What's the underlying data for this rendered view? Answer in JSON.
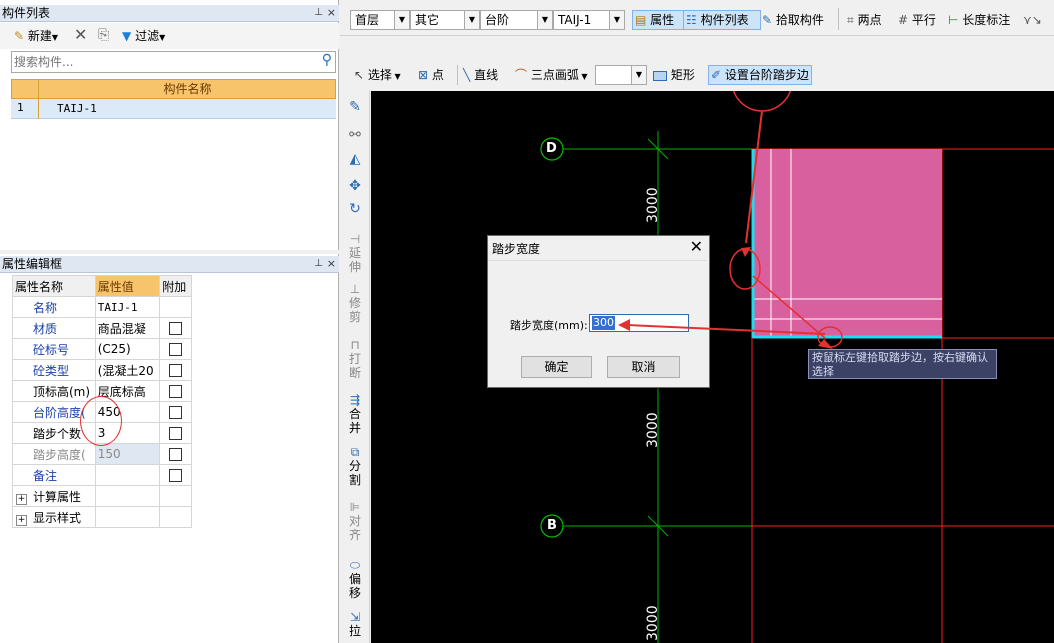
{
  "component_list_panel": {
    "title": "构件列表",
    "pin": "⊥",
    "close": "×",
    "new_label": "新建",
    "filter_label": "过滤",
    "search_placeholder": "搜索构件...",
    "column_header": "构件名称",
    "rows": [
      {
        "num": "1",
        "name": "TAIJ-1"
      }
    ]
  },
  "property_panel": {
    "title": "属性编辑框",
    "headers": {
      "name": "属性名称",
      "value": "属性值",
      "extra": "附加"
    },
    "rows": [
      {
        "name": "名称",
        "value": "TAIJ-1"
      },
      {
        "name": "材质",
        "value": "商品混凝"
      },
      {
        "name": "砼标号",
        "value": "(C25)"
      },
      {
        "name": "砼类型",
        "value": "(混凝土20"
      },
      {
        "name": "顶标高(m)",
        "value": "层底标高"
      },
      {
        "name": "台阶高度(",
        "value": "450"
      },
      {
        "name": "踏步个数",
        "value": "3"
      },
      {
        "name": "踏步高度(",
        "value": "150"
      },
      {
        "name": "备注",
        "value": ""
      }
    ],
    "groups": [
      "计算属性",
      "显示样式"
    ]
  },
  "toolbar1": {
    "floor": "首层",
    "category": "其它",
    "type": "台阶",
    "component": "TAIJ-1",
    "properties_label": "属性",
    "component_list_label": "构件列表",
    "pick_component_label": "拾取构件",
    "two_point_label": "两点",
    "parallel_label": "平行",
    "length_dim_label": "长度标注"
  },
  "toolbar2": {
    "select_label": "选择",
    "point_label": "点",
    "line_label": "直线",
    "arc_label": "三点画弧",
    "rect_label": "矩形",
    "set_step_edge_label": "设置台阶踏步边"
  },
  "side_tools": [
    {
      "label": "延伸"
    },
    {
      "label": "修剪"
    },
    {
      "label": "打断"
    },
    {
      "label": "合并"
    },
    {
      "label": "分割"
    },
    {
      "label": "对齐"
    },
    {
      "label": "偏移"
    },
    {
      "label": "拉"
    }
  ],
  "canvas": {
    "axis_d": "D",
    "axis_b": "B",
    "dim_top": "3000",
    "dim_mid": "3000",
    "dim_bottom": "3000",
    "tooltip": "按鼠标左键拾取踏步边，按右键确认选择"
  },
  "dialog": {
    "title": "踏步宽度",
    "field_label": "踏步宽度(mm):",
    "field_value": "300",
    "ok_label": "确定",
    "cancel_label": "取消"
  },
  "colors": {
    "canvas_bg": "#000000",
    "step_fill": "#d9609f",
    "cyan_edge": "#19e0f0",
    "axis_green": "#00c000",
    "red_line": "#ff2020",
    "annotation_red": "#e53030"
  }
}
